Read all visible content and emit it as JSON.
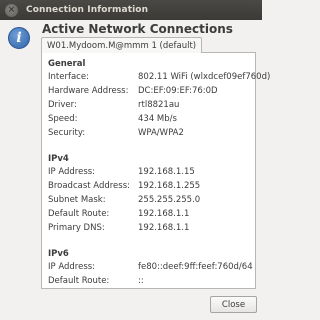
{
  "window": {
    "title": "Connection Information",
    "close_glyph": "×"
  },
  "header": {
    "title": "Active Network Connections",
    "icon": "info-icon",
    "icon_glyph": "i"
  },
  "tabs": [
    {
      "label": "W01.Mydoom.M@mmm 1 (default)"
    }
  ],
  "general": {
    "title": "General",
    "rows": [
      {
        "label": "Interface:",
        "value": "802.11 WiFi (wlxdcef09ef760d)"
      },
      {
        "label": "Hardware Address:",
        "value": "DC:EF:09:EF:76:0D"
      },
      {
        "label": "Driver:",
        "value": "rtl8821au"
      },
      {
        "label": "Speed:",
        "value": "434 Mb/s"
      },
      {
        "label": "Security:",
        "value": "WPA/WPA2"
      }
    ]
  },
  "ipv4": {
    "title": "IPv4",
    "rows": [
      {
        "label": "IP Address:",
        "value": "192.168.1.15"
      },
      {
        "label": "Broadcast Address:",
        "value": "192.168.1.255"
      },
      {
        "label": "Subnet Mask:",
        "value": "255.255.255.0"
      },
      {
        "label": "Default Route:",
        "value": "192.168.1.1"
      },
      {
        "label": "Primary DNS:",
        "value": "192.168.1.1"
      }
    ]
  },
  "ipv6": {
    "title": "IPv6",
    "rows": [
      {
        "label": "IP Address:",
        "value": "fe80::deef:9ff:feef:760d/64"
      },
      {
        "label": "Default Route:",
        "value": "::"
      }
    ]
  },
  "buttons": {
    "close_label": "Close"
  }
}
